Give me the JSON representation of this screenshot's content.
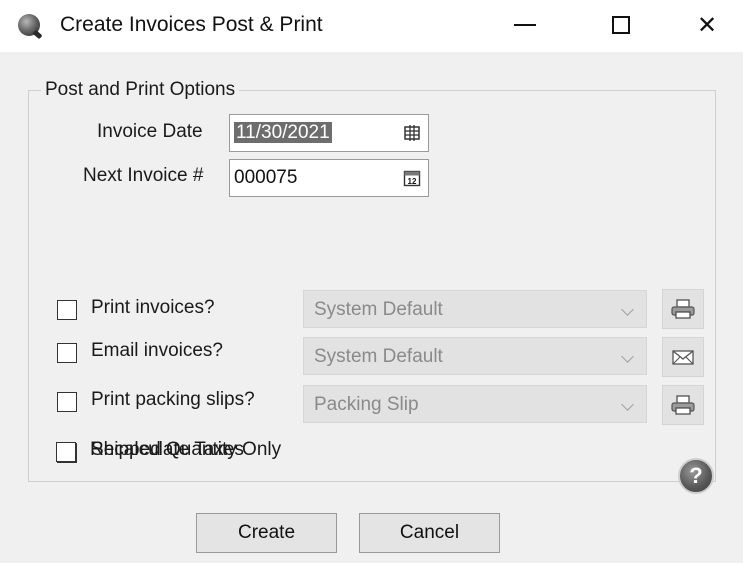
{
  "window": {
    "title": "Create Invoices Post & Print",
    "controls": {
      "minimize": "—",
      "maximize": "□",
      "close": "✕"
    }
  },
  "group": {
    "title": "Post and Print Options"
  },
  "fields": {
    "invoice_date_label": "Invoice Date",
    "invoice_date_value": "11/30/2021",
    "invoice_date_icon": "calendar-grid-icon",
    "next_invoice_label": "Next Invoice #",
    "next_invoice_value": "000075",
    "next_invoice_icon": "calendar-12-icon"
  },
  "options": [
    {
      "label": "Print invoices?",
      "checked": false,
      "combo": "System Default",
      "action_icon": "printer-icon"
    },
    {
      "label": "Email invoices?",
      "checked": false,
      "combo": "System Default",
      "action_icon": "envelope-icon"
    },
    {
      "label": "Print packing slips?",
      "checked": false,
      "combo": "Packing Slip",
      "action_icon": "printer-icon"
    }
  ],
  "checks": [
    {
      "label": "Shipped Quantity Only",
      "checked": false
    },
    {
      "label": "Recalculate Taxes",
      "checked": false
    }
  ],
  "buttons": {
    "create": "Create",
    "cancel": "Cancel",
    "help_icon": "help-question-icon"
  }
}
